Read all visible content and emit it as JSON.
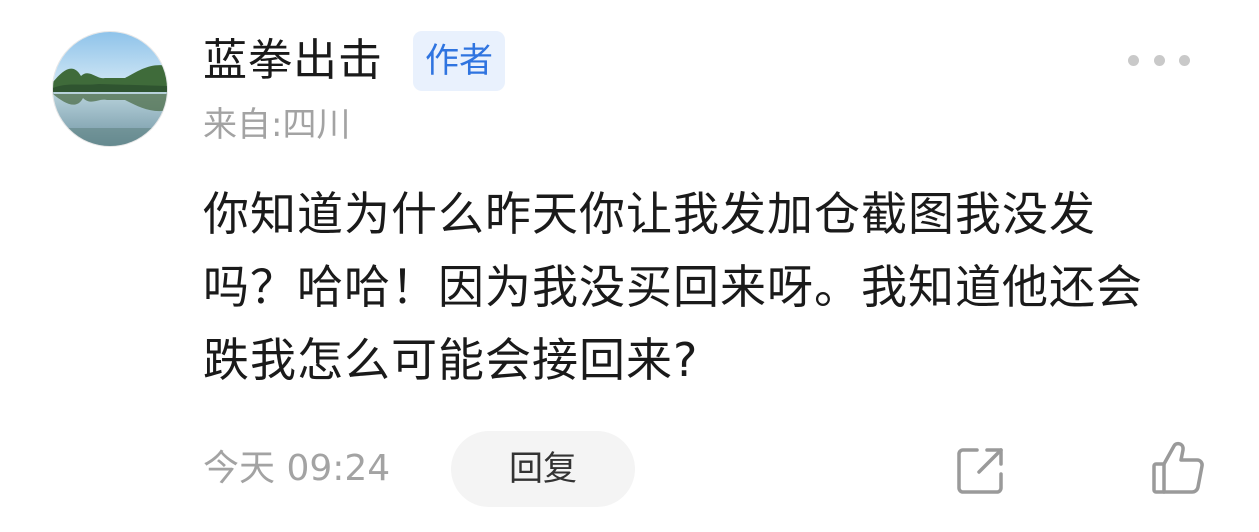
{
  "comment": {
    "avatar_icon": "avatar-lake-landscape-icon",
    "username": "蓝拳出击",
    "author_badge": "作者",
    "location": "来自:四川",
    "text_lines": [
      "你知道为什么昨天你让我发加仓截图我没发",
      "吗？哈哈！因为我没买回来呀。我知道他还会",
      "跌我怎么可能会接回来?"
    ],
    "timestamp": "今天 09:24",
    "reply_label": "回复",
    "icons": {
      "more": "more-dots-icon",
      "share": "share-icon",
      "like": "thumbs-up-icon"
    }
  },
  "colors": {
    "badge_background": "#e9f1fd",
    "badge_text": "#2f74e0",
    "muted_text": "#a3a3a3",
    "reply_background": "#f4f4f4"
  }
}
